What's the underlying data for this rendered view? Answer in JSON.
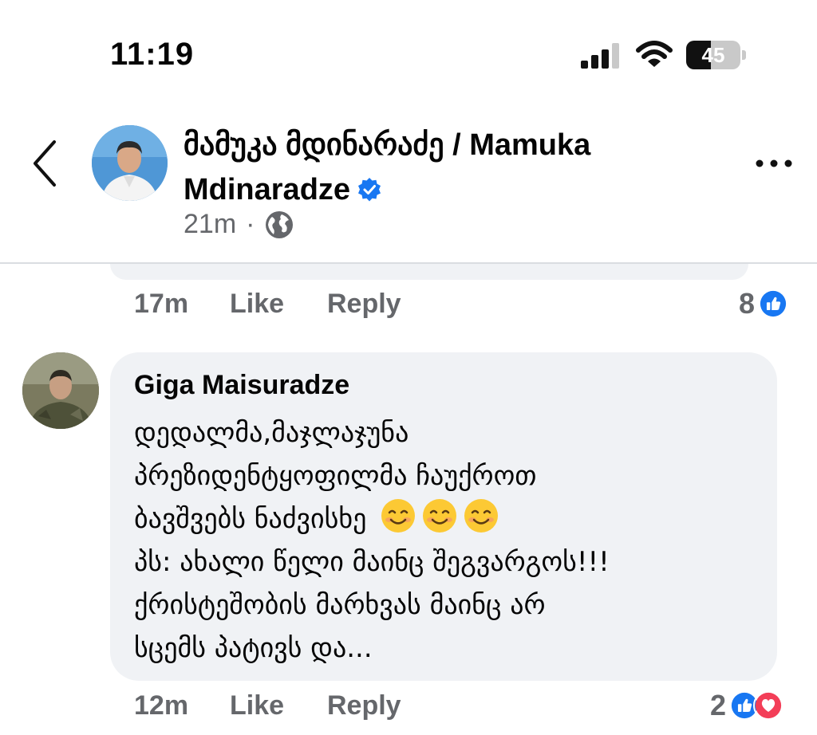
{
  "status_bar": {
    "time": "11:19",
    "battery_level": "45",
    "battery_fraction": 0.45
  },
  "post": {
    "author_name": "მამუკა მდინარაძე / Mamuka Mdinaradze",
    "time_ago": "21m",
    "separator": "·",
    "verified": true,
    "audience_icon": "globe-icon"
  },
  "previous_comment": {
    "time_ago": "17m",
    "like_label": "Like",
    "reply_label": "Reply",
    "reaction_count": "8",
    "reaction_icons": [
      "like-reaction-icon"
    ]
  },
  "comment": {
    "author": "Giga Maisuradze",
    "lines": [
      "დედალმა,მაჯლაჯუნა",
      "პრეზიდენტყოფილმა ჩაუქროთ",
      "ბავშვებს ნაძვისხე",
      "პს: ახალი წელი მაინც შეგვარგოს!!!",
      "ქრისტეშობის მარხვას მაინც არ",
      "სცემს პატივს და..."
    ],
    "emojis": [
      "smiling-face-icon",
      "smiling-face-icon",
      "smiling-face-icon"
    ],
    "time_ago": "12m",
    "like_label": "Like",
    "reply_label": "Reply",
    "reaction_count": "2",
    "reaction_icons": [
      "like-reaction-icon",
      "love-reaction-icon"
    ]
  },
  "colors": {
    "accent_blue": "#1877f2",
    "love_red": "#f33e58",
    "bubble_gray": "#f0f2f5",
    "secondary_text": "#65676b"
  }
}
